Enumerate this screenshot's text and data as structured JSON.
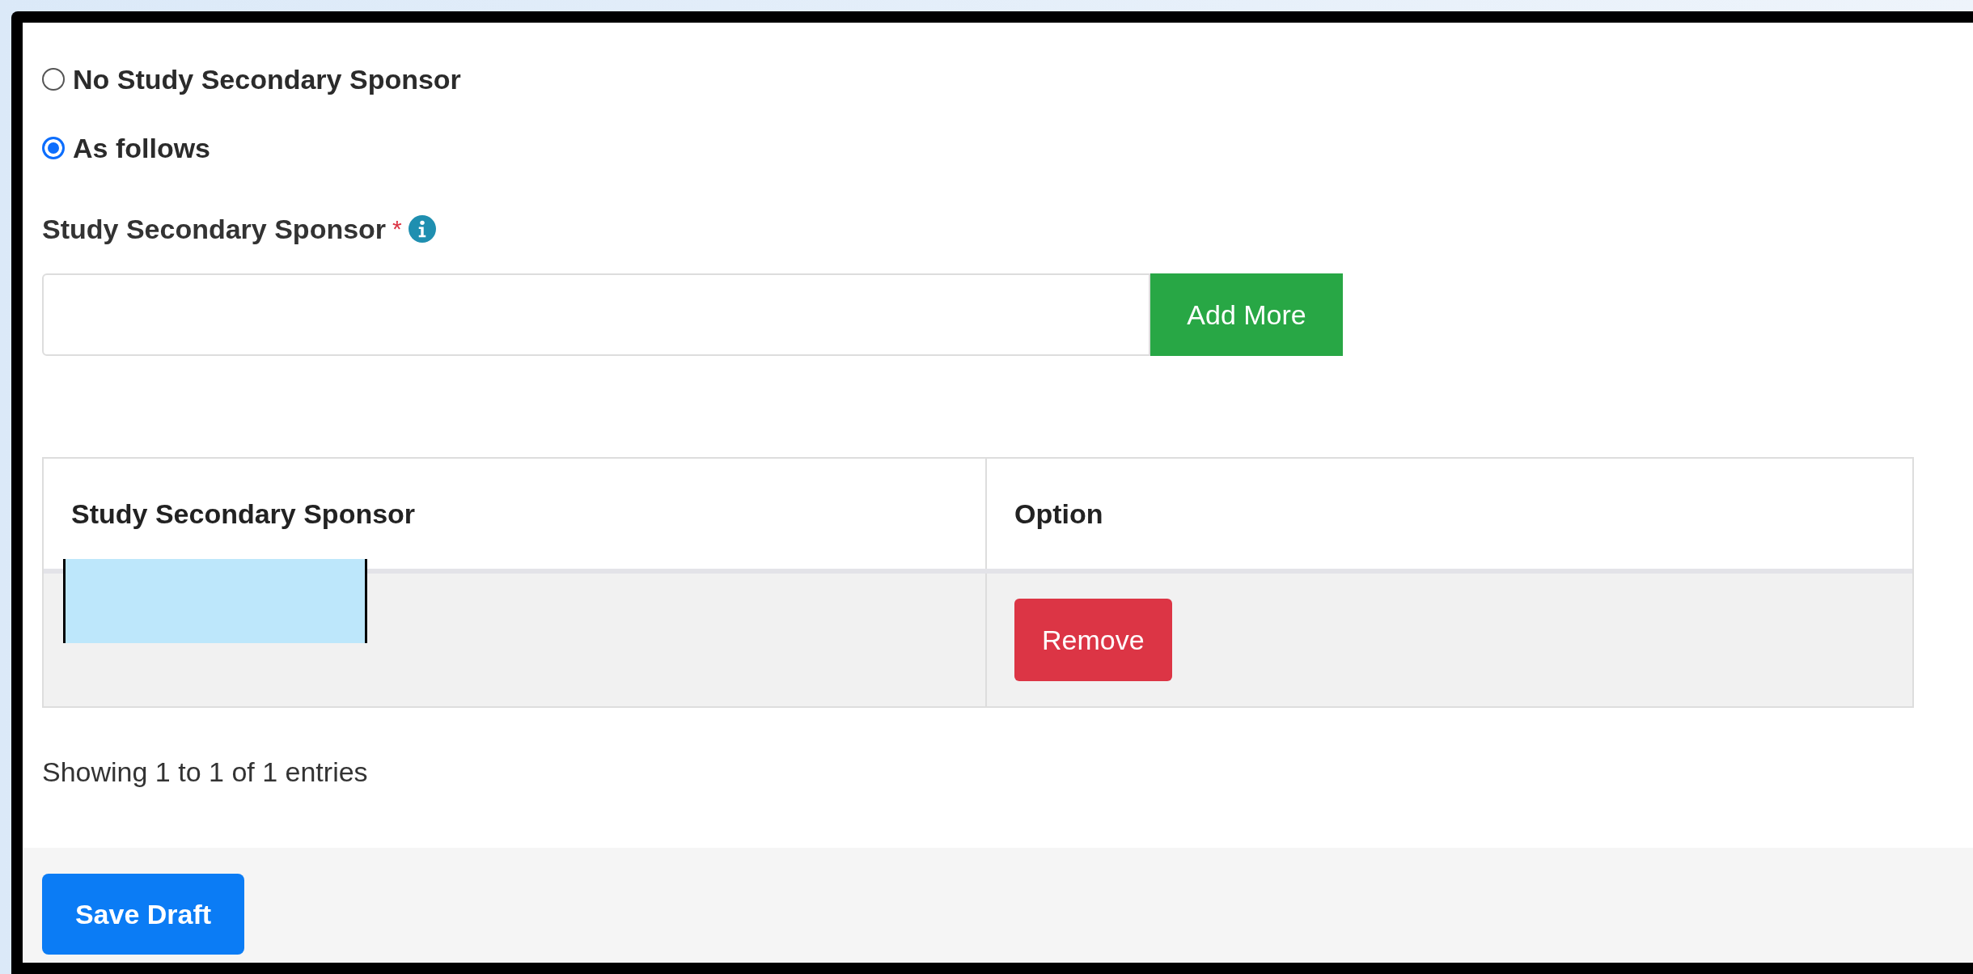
{
  "sponsor_options": [
    {
      "label": "No Study Secondary Sponsor",
      "selected": false
    },
    {
      "label": "As follows",
      "selected": true
    }
  ],
  "field": {
    "label": "Study Secondary Sponsor",
    "required_mark": "*",
    "add_button": "Add More"
  },
  "table": {
    "columns": [
      "Study Secondary Sponsor",
      "Option"
    ],
    "rows": [
      {
        "redacted": true,
        "action": "Remove"
      }
    ]
  },
  "entries_info": "Showing 1 to 1 of 1 entries",
  "footer": {
    "save_button": "Save Draft"
  }
}
